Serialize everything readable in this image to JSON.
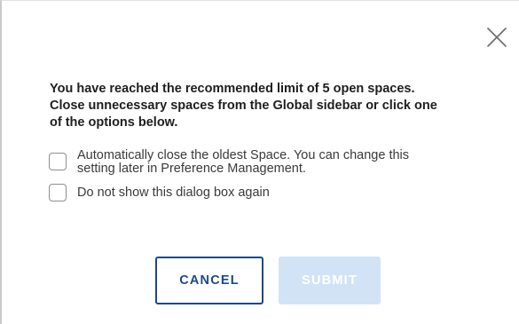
{
  "dialog": {
    "message_lines": [
      "You have reached the recommended limit of 5 open spaces.",
      "Close unnecessary spaces from the Global sidebar or click one",
      "of the options below."
    ],
    "options": [
      {
        "lines": [
          "Automatically close the oldest Space. You can change this",
          "setting later in Preference Management."
        ],
        "checked": false
      },
      {
        "lines": [
          "Do not show this dialog box again"
        ],
        "checked": false
      }
    ],
    "buttons": {
      "cancel_label": "CANCEL",
      "submit_label": "SUBMIT",
      "submit_enabled": false
    },
    "icons": {
      "close": "close-icon"
    },
    "colors": {
      "primary": "#1b4a86",
      "disabled_button": "#d3e3f6"
    }
  }
}
